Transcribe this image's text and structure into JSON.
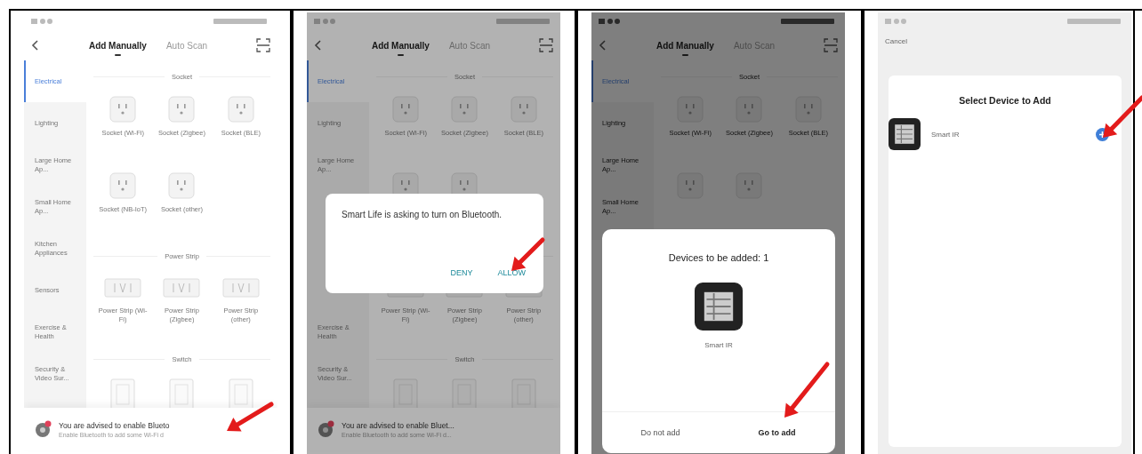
{
  "panels": [
    {
      "kind": "catalog",
      "tabs": [
        {
          "label": "Add Manually",
          "selected": true
        },
        {
          "label": "Auto Scan",
          "selected": false
        }
      ],
      "categories": [
        {
          "kind": "text",
          "label": "Electrical",
          "selected": true
        },
        {
          "kind": "text",
          "label": "Lighting",
          "selected": false
        },
        {
          "kind": "text",
          "label": "Large Home Ap...",
          "selected": false
        },
        {
          "kind": "text",
          "label": "Small Home Ap...",
          "selected": false
        },
        {
          "kind": "text",
          "label": "Kitchen Appliances",
          "selected": false
        },
        {
          "kind": "text",
          "label": "Sensors",
          "selected": false
        },
        {
          "kind": "text",
          "label": "Exercise & Health",
          "selected": false
        },
        {
          "kind": "text",
          "label": "Security & Video Sur...",
          "selected": false
        }
      ],
      "sections": [
        {
          "title": "Socket",
          "devices": [
            {
              "kind": "socket",
              "label": "Socket (Wi-Fi)"
            },
            {
              "kind": "socket",
              "label": "Socket (Zigbee)"
            },
            {
              "kind": "socket",
              "label": "Socket (BLE)"
            },
            {
              "kind": "socket",
              "label": "Socket (NB-IoT)"
            },
            {
              "kind": "socket",
              "label": "Socket (other)"
            }
          ]
        },
        {
          "title": "Power Strip",
          "devices": [
            {
              "kind": "strip",
              "label": "Power Strip (Wi-Fi)"
            },
            {
              "kind": "strip",
              "label": "Power Strip (Zigbee)"
            },
            {
              "kind": "strip",
              "label": "Power Strip (other)"
            }
          ]
        },
        {
          "title": "Switch",
          "devices": [
            {
              "kind": "switch"
            },
            {
              "kind": "switch"
            },
            {
              "kind": "switch"
            }
          ]
        }
      ],
      "banner": {
        "title": "You are advised to enable Blueto",
        "subtitle": "Enable Bluetooth to add some Wi-Fi d"
      }
    },
    {
      "kind": "catalog",
      "tabs": [
        {
          "label": "Add Manually",
          "selected": true
        },
        {
          "label": "Auto Scan",
          "selected": false
        }
      ],
      "categories": [
        {
          "kind": "text",
          "label": "Electrical",
          "selected": true
        },
        {
          "kind": "text",
          "label": "Lighting",
          "selected": false
        },
        {
          "kind": "text",
          "label": "Large Home Ap...",
          "selected": false
        },
        {
          "kind": "covered",
          "selected": false
        },
        {
          "kind": "covered",
          "selected": false
        },
        {
          "kind": "covered",
          "selected": false
        },
        {
          "kind": "text",
          "label": "Exercise & Health",
          "selected": false
        },
        {
          "kind": "text",
          "label": "Security & Video Sur...",
          "selected": false
        }
      ],
      "sections": [
        {
          "title": "Socket",
          "devices": [
            {
              "kind": "socket",
              "label": "Socket (Wi-Fi)"
            },
            {
              "kind": "socket",
              "label": "Socket (Zigbee)"
            },
            {
              "kind": "socket",
              "label": "Socket (BLE)"
            },
            {
              "kind": "socket"
            },
            {
              "kind": "socket"
            }
          ]
        },
        {
          "devices": [
            {
              "kind": "strip",
              "label": "Power Strip (Wi-Fi)"
            },
            {
              "kind": "strip",
              "label": "Power Strip (Zigbee)"
            },
            {
              "kind": "strip",
              "label": "Power Strip (other)"
            }
          ]
        },
        {
          "title": "Switch",
          "devices": [
            {
              "kind": "switch"
            },
            {
              "kind": "switch"
            },
            {
              "kind": "switch"
            }
          ]
        }
      ],
      "banner": {
        "title": "You are advised to enable Bluet...",
        "subtitle": "Enable Bluetooth to add some Wi-Fi d..."
      },
      "dialog": {
        "message": "Smart Life is asking to turn on Bluetooth.",
        "buttons": [
          {
            "label": "DENY"
          },
          {
            "label": "ALLOW"
          }
        ]
      }
    },
    {
      "kind": "catalog",
      "tabs": [
        {
          "label": "Add Manually",
          "selected": true
        },
        {
          "label": "Auto Scan",
          "selected": false
        }
      ],
      "categories": [
        {
          "kind": "text",
          "label": "Electrical",
          "selected": true
        },
        {
          "kind": "text",
          "label": "Lighting",
          "selected": false
        },
        {
          "kind": "text",
          "label": "Large Home Ap...",
          "selected": false
        },
        {
          "kind": "text",
          "label": "Small Home Ap...",
          "selected": false
        }
      ],
      "sections": [
        {
          "title": "Socket",
          "devices": [
            {
              "kind": "socket",
              "label": "Socket (Wi-Fi)"
            },
            {
              "kind": "socket",
              "label": "Socket (Zigbee)"
            },
            {
              "kind": "socket",
              "label": "Socket (BLE)"
            },
            {
              "kind": "socket"
            },
            {
              "kind": "socket"
            }
          ]
        }
      ],
      "sheet": {
        "title": "Devices to be added: 1",
        "device": "Smart IR",
        "buttons": [
          {
            "label": "Do not add",
            "primary": false
          },
          {
            "label": "Go to add",
            "primary": true
          }
        ]
      }
    },
    {
      "kind": "select",
      "cancel": "Cancel",
      "title": "Select Device to Add",
      "devices": [
        {
          "name": "Smart IR"
        }
      ]
    }
  ]
}
